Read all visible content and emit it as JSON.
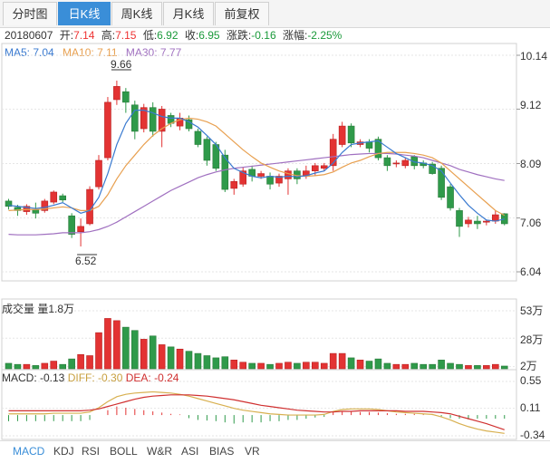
{
  "tabs": [
    {
      "label": "分时图",
      "active": false
    },
    {
      "label": "日K线",
      "active": true
    },
    {
      "label": "周K线",
      "active": false
    },
    {
      "label": "月K线",
      "active": false
    },
    {
      "label": "前复权",
      "active": false
    }
  ],
  "info": {
    "date": "20180607",
    "open_label": "开:",
    "open": "7.14",
    "high_label": "高:",
    "high": "7.15",
    "low_label": "低:",
    "low": "6.92",
    "close_label": "收:",
    "close": "6.95",
    "chg_label": "涨跌:",
    "chg": "-0.16",
    "pct_label": "涨幅:",
    "pct": "-2.25%"
  },
  "ma": {
    "ma5": "MA5: 7.04",
    "ma10": "MA10: 7.11",
    "ma30": "MA30: 7.77"
  },
  "volume": {
    "label": "成交量 量1.8万"
  },
  "macd": {
    "label": "MACD: -0.13",
    "diff": "DIFF: -0.30",
    "dea": "DEA: -0.24"
  },
  "bottom_tabs": [
    {
      "label": "MACD",
      "active": true
    },
    {
      "label": "KDJ",
      "active": false
    },
    {
      "label": "RSI",
      "active": false
    },
    {
      "label": "BOLL",
      "active": false
    },
    {
      "label": "W&R",
      "active": false
    },
    {
      "label": "ASI",
      "active": false
    },
    {
      "label": "BIAS",
      "active": false
    },
    {
      "label": "VR",
      "active": false
    }
  ],
  "colors": {
    "up": "#e33333",
    "down": "#2f9a4a",
    "ma5": "#3a7ad0",
    "ma10": "#e8a050",
    "ma30": "#a070c0",
    "diff": "#d8b050",
    "dea": "#d03030"
  },
  "chart_data": {
    "type": "candlestick",
    "price_axis": {
      "ticks": [
        "10.14",
        "9.12",
        "8.09",
        "7.06",
        "6.04"
      ],
      "range": [
        6.04,
        10.14
      ]
    },
    "annotations": {
      "max": "9.66",
      "min": "6.52"
    },
    "candles": [
      [
        7.38,
        7.28,
        7.42,
        7.22
      ],
      [
        7.26,
        7.2,
        7.31,
        7.1
      ],
      [
        7.18,
        7.28,
        7.32,
        7.12
      ],
      [
        7.22,
        7.15,
        7.35,
        7.05
      ],
      [
        7.2,
        7.38,
        7.42,
        7.16
      ],
      [
        7.36,
        7.55,
        7.58,
        7.32
      ],
      [
        7.48,
        7.4,
        7.52,
        7.36
      ],
      [
        7.1,
        6.75,
        7.15,
        6.68
      ],
      [
        6.8,
        6.9,
        7.05,
        6.52
      ],
      [
        6.95,
        7.6,
        7.66,
        6.92
      ],
      [
        7.65,
        8.15,
        8.25,
        7.6
      ],
      [
        8.2,
        9.25,
        9.35,
        8.15
      ],
      [
        9.3,
        9.55,
        9.66,
        9.2
      ],
      [
        9.45,
        9.25,
        9.52,
        9.05
      ],
      [
        9.2,
        8.7,
        9.28,
        8.55
      ],
      [
        8.75,
        9.15,
        9.22,
        8.68
      ],
      [
        9.15,
        8.7,
        9.25,
        8.6
      ],
      [
        8.7,
        9.12,
        9.18,
        8.4
      ],
      [
        9.0,
        8.85,
        9.05,
        8.78
      ],
      [
        8.8,
        8.95,
        9.05,
        8.72
      ],
      [
        8.92,
        8.75,
        9.0,
        8.7
      ],
      [
        8.7,
        8.45,
        8.75,
        8.4
      ],
      [
        8.55,
        8.15,
        8.6,
        8.05
      ],
      [
        8.45,
        8.0,
        8.5,
        7.95
      ],
      [
        8.25,
        7.6,
        8.35,
        7.55
      ],
      [
        7.62,
        7.75,
        7.8,
        7.5
      ],
      [
        7.7,
        7.95,
        8.02,
        7.65
      ],
      [
        7.98,
        7.85,
        8.05,
        7.75
      ],
      [
        7.85,
        7.9,
        7.95,
        7.8
      ],
      [
        7.85,
        7.7,
        7.92,
        7.6
      ],
      [
        7.72,
        7.85,
        7.9,
        7.65
      ],
      [
        7.8,
        7.95,
        8.0,
        7.5
      ],
      [
        7.95,
        7.8,
        8.0,
        7.7
      ],
      [
        7.85,
        7.95,
        8.05,
        7.8
      ],
      [
        7.95,
        8.05,
        8.1,
        7.85
      ],
      [
        8.0,
        8.05,
        8.1,
        7.95
      ],
      [
        8.05,
        8.55,
        8.65,
        7.95
      ],
      [
        8.45,
        8.8,
        8.88,
        8.4
      ],
      [
        8.8,
        8.48,
        8.85,
        8.4
      ],
      [
        8.45,
        8.5,
        8.55,
        8.4
      ],
      [
        8.5,
        8.38,
        8.55,
        8.3
      ],
      [
        8.55,
        8.2,
        8.6,
        8.15
      ],
      [
        8.2,
        8.05,
        8.25,
        7.95
      ],
      [
        8.1,
        8.1,
        8.15,
        8.02
      ],
      [
        8.05,
        8.15,
        8.2,
        8.0
      ],
      [
        8.22,
        8.05,
        8.25,
        7.98
      ],
      [
        8.1,
        8.05,
        8.15,
        8.0
      ],
      [
        8.08,
        7.9,
        8.12,
        7.88
      ],
      [
        8.0,
        7.45,
        8.05,
        7.4
      ],
      [
        7.65,
        7.25,
        7.7,
        7.2
      ],
      [
        7.2,
        6.9,
        7.25,
        6.7
      ],
      [
        6.95,
        7.02,
        7.08,
        6.88
      ],
      [
        7.0,
        6.95,
        7.1,
        6.85
      ],
      [
        6.98,
        7.0,
        7.02,
        6.92
      ],
      [
        7.0,
        7.12,
        7.2,
        6.95
      ],
      [
        7.14,
        6.95,
        7.15,
        6.92
      ]
    ],
    "ma5": [
      7.3,
      7.28,
      7.26,
      7.24,
      7.26,
      7.3,
      7.35,
      7.25,
      7.15,
      7.2,
      7.45,
      7.9,
      8.45,
      8.85,
      9.1,
      9.1,
      9.05,
      8.98,
      8.95,
      8.95,
      8.88,
      8.78,
      8.62,
      8.45,
      8.2,
      8.0,
      7.92,
      7.85,
      7.82,
      7.85,
      7.83,
      7.85,
      7.84,
      7.86,
      7.91,
      7.95,
      8.1,
      8.3,
      8.45,
      8.48,
      8.5,
      8.52,
      8.4,
      8.28,
      8.2,
      8.12,
      8.1,
      8.05,
      7.95,
      7.72,
      7.5,
      7.3,
      7.15,
      7.02,
      7.0,
      7.04
    ],
    "ma10": [
      7.2,
      7.21,
      7.22,
      7.22,
      7.23,
      7.25,
      7.27,
      7.25,
      7.2,
      7.2,
      7.28,
      7.5,
      7.8,
      8.05,
      8.25,
      8.45,
      8.62,
      8.75,
      8.85,
      8.92,
      8.95,
      8.93,
      8.88,
      8.8,
      8.65,
      8.5,
      8.35,
      8.22,
      8.1,
      8.02,
      7.95,
      7.9,
      7.86,
      7.85,
      7.86,
      7.88,
      7.93,
      8.02,
      8.1,
      8.15,
      8.22,
      8.28,
      8.3,
      8.3,
      8.3,
      8.28,
      8.25,
      8.2,
      8.1,
      7.95,
      7.8,
      7.65,
      7.5,
      7.35,
      7.2,
      7.11
    ],
    "ma30": [
      6.75,
      6.74,
      6.74,
      6.74,
      6.75,
      6.76,
      6.78,
      6.78,
      6.78,
      6.8,
      6.84,
      6.9,
      6.98,
      7.08,
      7.18,
      7.28,
      7.38,
      7.48,
      7.58,
      7.66,
      7.74,
      7.82,
      7.88,
      7.93,
      7.97,
      8.0,
      8.02,
      8.04,
      8.06,
      8.08,
      8.1,
      8.12,
      8.14,
      8.16,
      8.18,
      8.2,
      8.22,
      8.24,
      8.26,
      8.27,
      8.28,
      8.28,
      8.28,
      8.27,
      8.25,
      8.23,
      8.2,
      8.15,
      8.1,
      8.05,
      7.98,
      7.93,
      7.88,
      7.84,
      7.8,
      7.77
    ]
  },
  "volume_chart": {
    "type": "bar",
    "ticks": [
      "53万",
      "28万",
      "2万"
    ],
    "values": [
      5,
      4,
      4,
      3,
      5,
      7,
      4,
      9,
      13,
      12,
      33,
      46,
      44,
      38,
      35,
      27,
      30,
      22,
      20,
      18,
      16,
      14,
      12,
      10,
      11,
      8,
      6,
      5,
      5,
      4,
      5,
      6,
      5,
      6,
      6,
      5,
      14,
      14,
      10,
      8,
      7,
      9,
      5,
      4,
      4,
      5,
      4,
      4,
      8,
      5,
      4,
      3,
      3,
      3,
      4,
      2.5
    ]
  },
  "macd_chart": {
    "type": "bar+line",
    "ticks": [
      "0.55",
      "0.11",
      "-0.34"
    ],
    "histogram": [
      -0.1,
      -0.1,
      -0.1,
      -0.1,
      -0.1,
      -0.1,
      -0.1,
      -0.1,
      -0.1,
      -0.08,
      0.0,
      0.08,
      0.14,
      0.12,
      0.1,
      0.08,
      0.06,
      0.04,
      0.02,
      0.01,
      -0.05,
      -0.08,
      -0.09,
      -0.1,
      -0.12,
      -0.14,
      -0.12,
      -0.12,
      -0.12,
      -0.1,
      -0.1,
      -0.08,
      -0.08,
      -0.06,
      -0.04,
      -0.03,
      0.05,
      0.06,
      0.06,
      0.05,
      0.05,
      0.04,
      0.03,
      0.02,
      0.02,
      0.02,
      0.01,
      0.01,
      -0.02,
      -0.05,
      -0.06,
      -0.07,
      -0.06,
      -0.06,
      -0.06,
      -0.06
    ],
    "diff": [
      0.02,
      0.02,
      0.02,
      0.02,
      0.02,
      0.03,
      0.03,
      0.03,
      0.03,
      0.05,
      0.12,
      0.22,
      0.3,
      0.34,
      0.36,
      0.37,
      0.38,
      0.37,
      0.36,
      0.34,
      0.31,
      0.27,
      0.23,
      0.19,
      0.15,
      0.11,
      0.08,
      0.06,
      0.04,
      0.02,
      0.01,
      0.0,
      0.0,
      0.0,
      0.0,
      0.01,
      0.06,
      0.09,
      0.1,
      0.1,
      0.1,
      0.09,
      0.07,
      0.05,
      0.04,
      0.03,
      0.02,
      0.01,
      -0.03,
      -0.08,
      -0.14,
      -0.19,
      -0.23,
      -0.26,
      -0.28,
      -0.3
    ],
    "dea": [
      0.07,
      0.07,
      0.07,
      0.07,
      0.07,
      0.07,
      0.07,
      0.07,
      0.07,
      0.08,
      0.1,
      0.14,
      0.18,
      0.22,
      0.26,
      0.29,
      0.31,
      0.32,
      0.33,
      0.33,
      0.33,
      0.32,
      0.31,
      0.29,
      0.27,
      0.25,
      0.22,
      0.19,
      0.16,
      0.14,
      0.12,
      0.1,
      0.08,
      0.07,
      0.06,
      0.05,
      0.05,
      0.06,
      0.06,
      0.07,
      0.07,
      0.07,
      0.07,
      0.07,
      0.06,
      0.06,
      0.06,
      0.05,
      0.04,
      0.02,
      -0.02,
      -0.06,
      -0.1,
      -0.14,
      -0.19,
      -0.24
    ]
  }
}
